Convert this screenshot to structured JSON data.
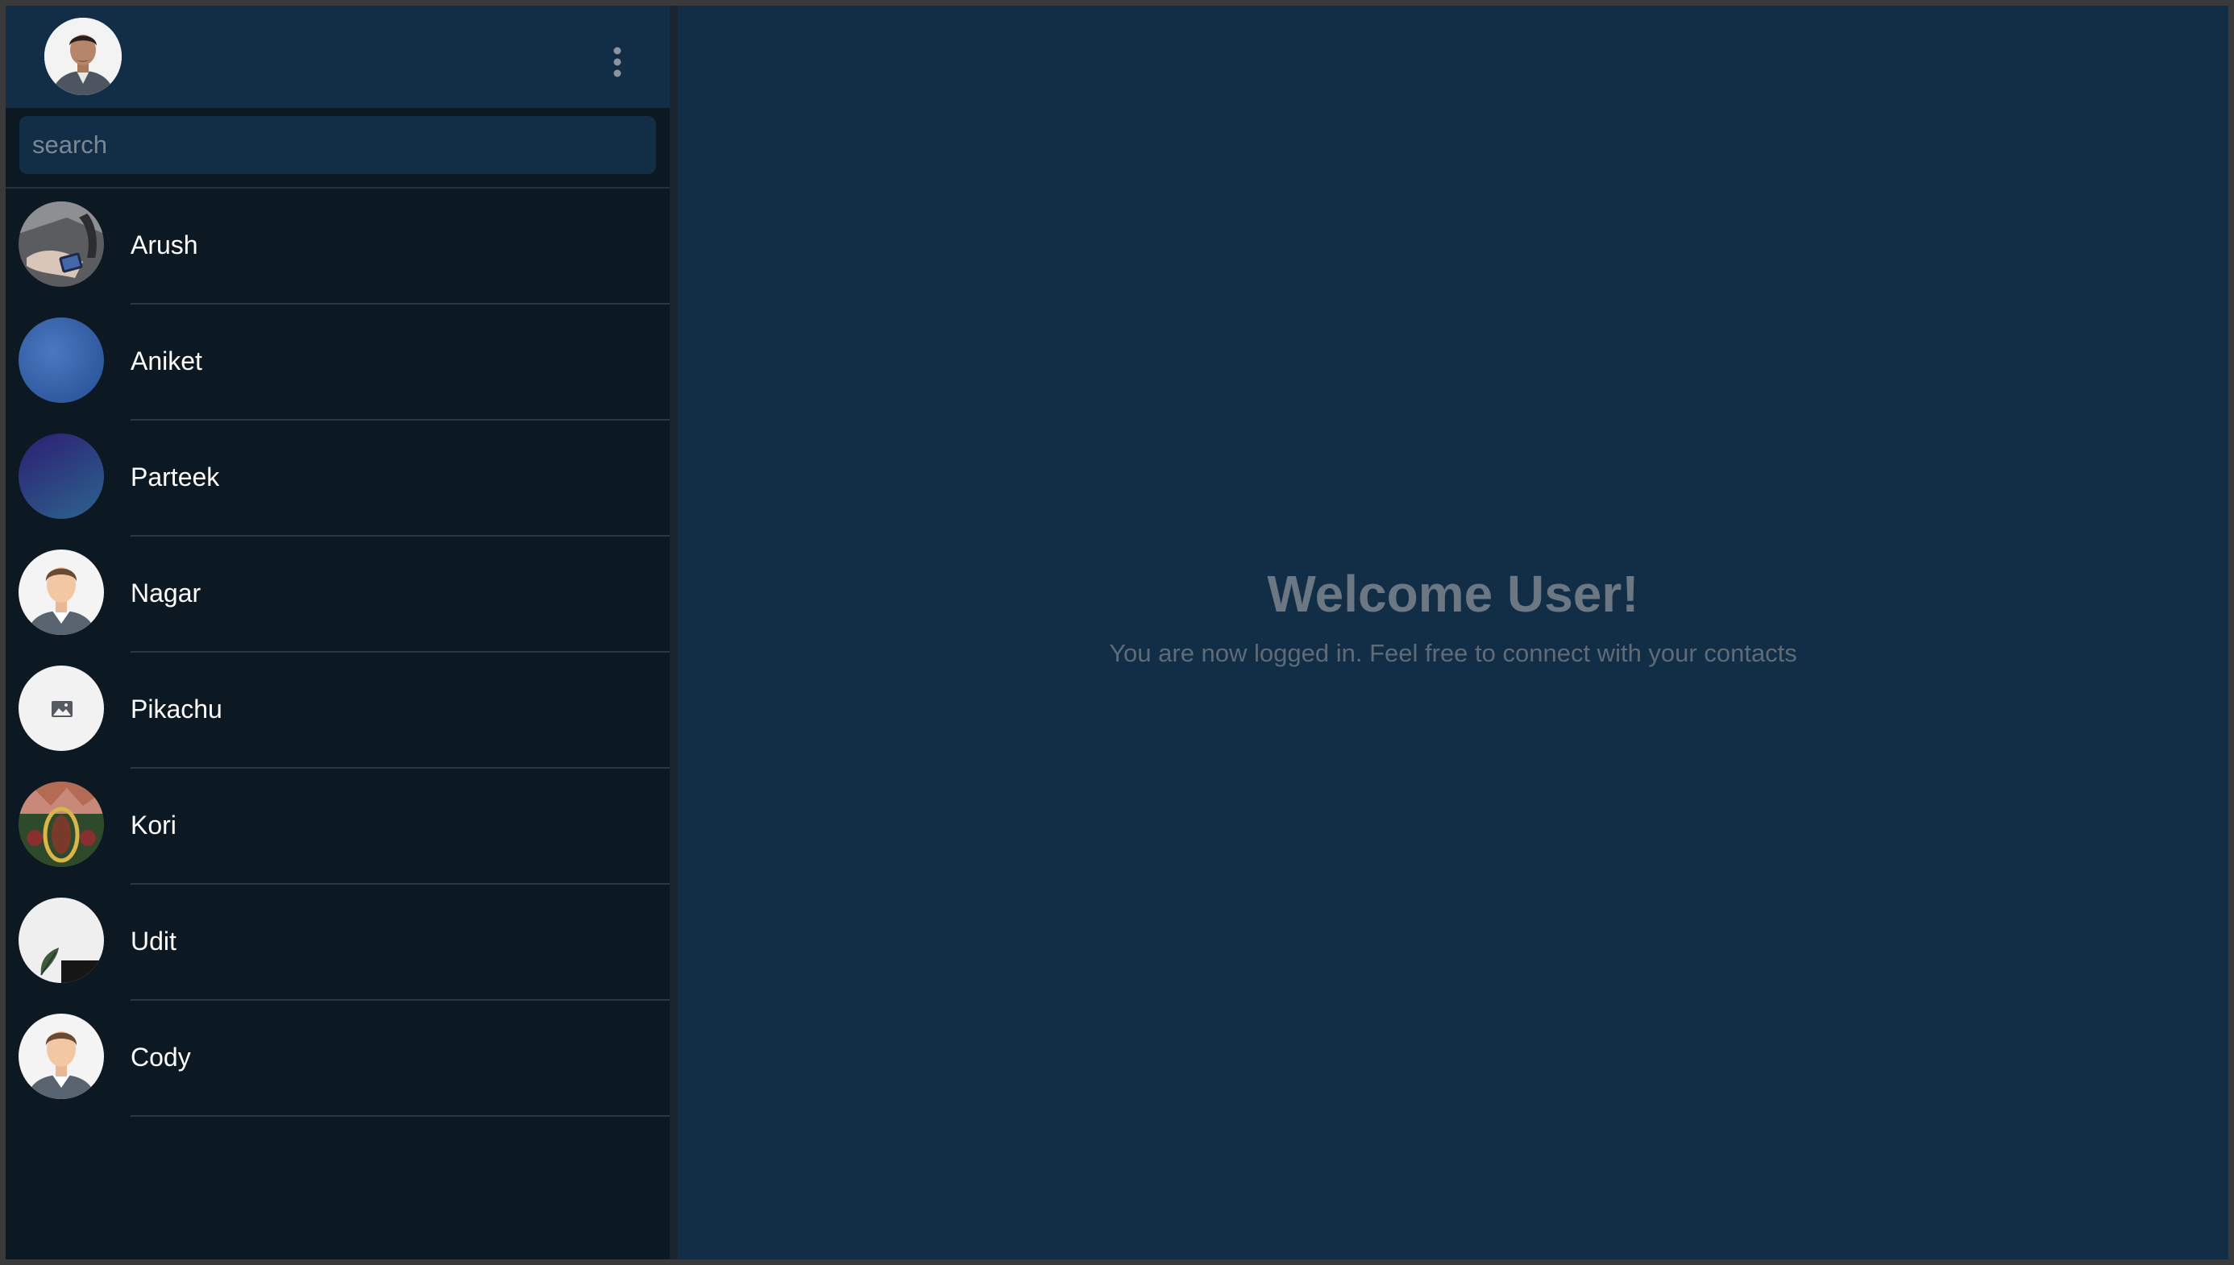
{
  "header": {
    "profile_avatar": "profile-photo",
    "menu_icon": "more-vertical-icon"
  },
  "search": {
    "placeholder": "search",
    "value": ""
  },
  "contacts": [
    {
      "name": "Arush",
      "avatar": "photo-hands-phone"
    },
    {
      "name": "Aniket",
      "avatar": "blue-texture"
    },
    {
      "name": "Parteek",
      "avatar": "purple-gradient"
    },
    {
      "name": "Nagar",
      "avatar": "default-male-avatar"
    },
    {
      "name": "Pikachu",
      "avatar": "image-placeholder-icon"
    },
    {
      "name": "Kori",
      "avatar": "photo-decorated"
    },
    {
      "name": "Udit",
      "avatar": "photo-leaf"
    },
    {
      "name": "Cody",
      "avatar": "default-male-avatar"
    }
  ],
  "main": {
    "title": "Welcome User!",
    "subtitle": "You are now logged in. Feel free to connect with your contacts"
  },
  "colors": {
    "sidebar_bg": "#0c1822",
    "header_bg": "#122d46",
    "main_bg": "#122d46",
    "text": "#ffffff",
    "muted": "#6b7884"
  }
}
